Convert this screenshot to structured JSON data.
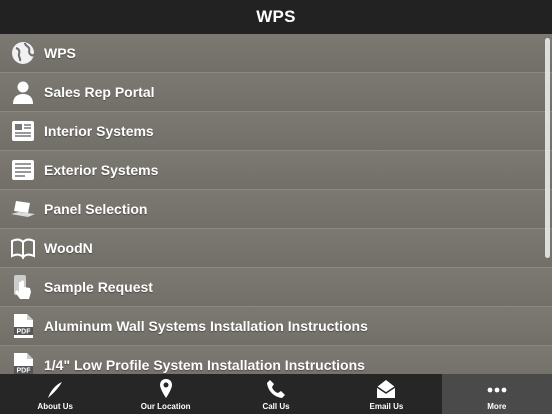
{
  "header": {
    "title": "WPS"
  },
  "menu": {
    "items": [
      {
        "label": "WPS",
        "icon": "globe-icon"
      },
      {
        "label": "Sales Rep Portal",
        "icon": "person-icon"
      },
      {
        "label": "Interior Systems",
        "icon": "newspaper-icon"
      },
      {
        "label": "Exterior Systems",
        "icon": "document-icon"
      },
      {
        "label": "Panel Selection",
        "icon": "laptop-icon"
      },
      {
        "label": "WoodN",
        "icon": "book-icon"
      },
      {
        "label": "Sample Request",
        "icon": "touch-icon"
      },
      {
        "label": "Aluminum Wall Systems Installation Instructions",
        "icon": "pdf-icon"
      },
      {
        "label": "1/4\" Low Profile System Installation Instructions",
        "icon": "pdf-icon"
      }
    ]
  },
  "tabs": [
    {
      "label": "About Us",
      "icon": "feather-icon"
    },
    {
      "label": "Our Location",
      "icon": "map-pin-icon"
    },
    {
      "label": "Call Us",
      "icon": "phone-icon"
    },
    {
      "label": "Email Us",
      "icon": "envelope-icon"
    },
    {
      "label": "More",
      "icon": "more-dots-icon",
      "active": true
    }
  ]
}
